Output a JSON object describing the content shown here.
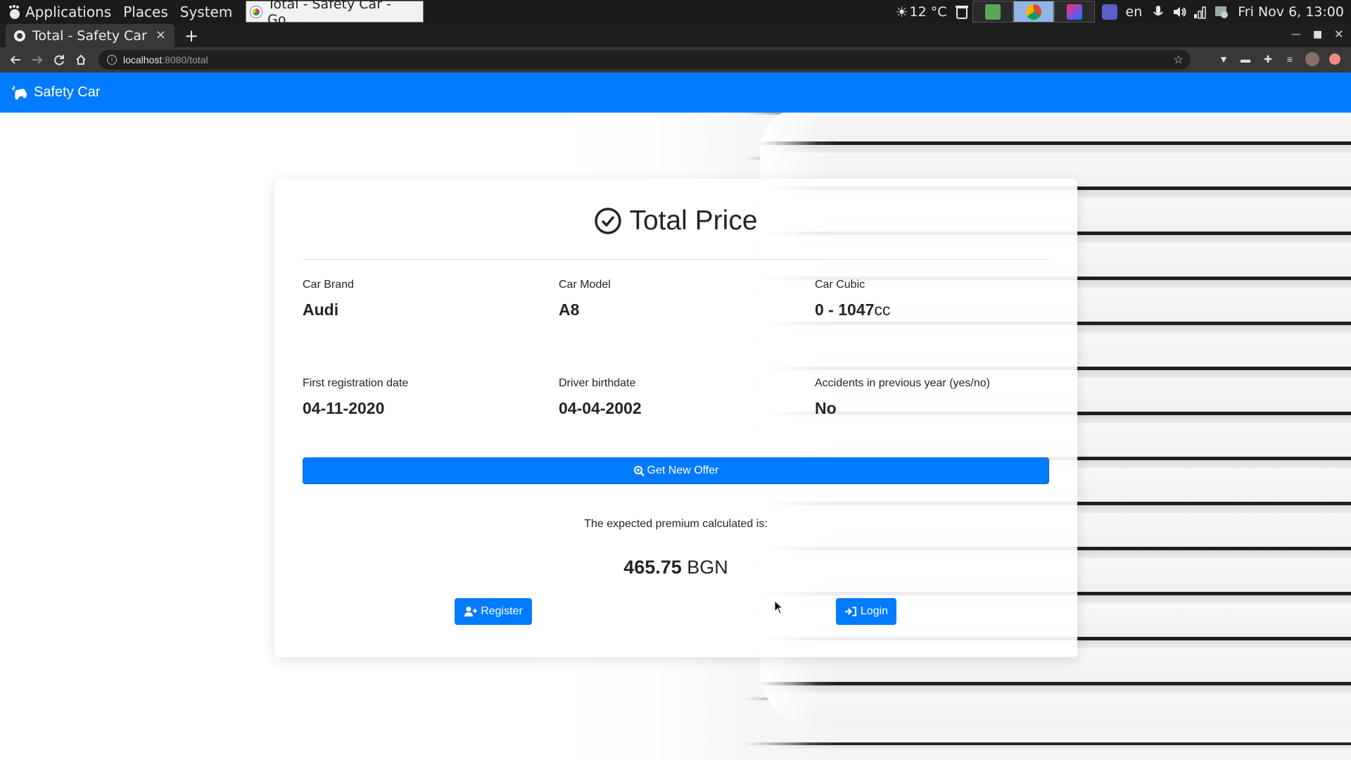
{
  "os_panel": {
    "menus": [
      "Applications",
      "Places",
      "System"
    ],
    "task_title": "Total - Safety Car - Go...",
    "weather": "12 °C",
    "language": "en",
    "clock": "Fri Nov  6, 13:00"
  },
  "browser": {
    "tab_title": "Total - Safety Car",
    "tab_close": "×",
    "new_tab": "+",
    "url_host": "localhost",
    "url_path": ":8080/total"
  },
  "navbar": {
    "brand": "Safety Car"
  },
  "card": {
    "title": "Total Price",
    "fields": [
      {
        "label": "Car Brand",
        "value": "Audi"
      },
      {
        "label": "Car Model",
        "value": "A8"
      },
      {
        "label": "Car Cubic",
        "value": "0 - 1047",
        "unit": "cc"
      },
      {
        "label": "First registration date",
        "value": "04-11-2020"
      },
      {
        "label": "Driver birthdate",
        "value": "04-04-2002"
      },
      {
        "label": "Accidents in previous year (yes/no)",
        "value": "No"
      }
    ],
    "offer_button": "Get New Offer",
    "premium_text": "The expected premium calculated is:",
    "premium_amount": "465.75",
    "premium_currency": "BGN",
    "register_button": "Register",
    "login_button": "Login"
  },
  "colors": {
    "primary": "#007bff",
    "text": "#212529",
    "os_panel": "#1b1b1b"
  }
}
